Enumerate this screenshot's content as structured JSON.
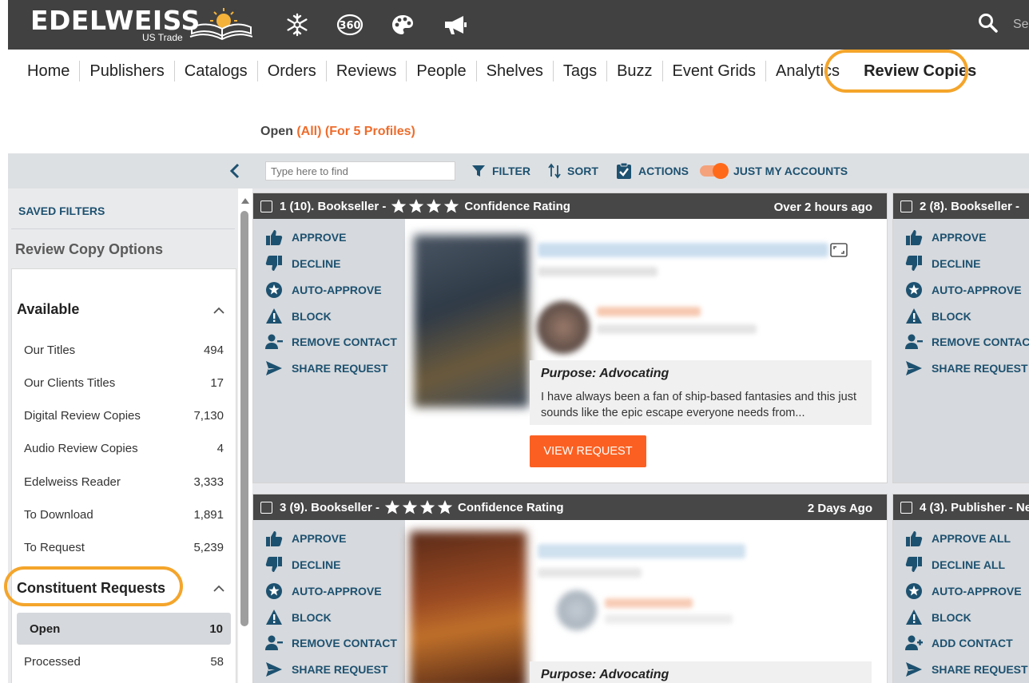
{
  "header": {
    "logo_text": "EDELWEISS",
    "logo_sub": "US Trade",
    "icons": [
      "snowflake-icon",
      "360-icon",
      "palette-icon",
      "megaphone-icon",
      "search-icon"
    ],
    "search_fragment": "Se"
  },
  "nav": {
    "items": [
      "Home",
      "Publishers",
      "Catalogs",
      "Orders",
      "Reviews",
      "People",
      "Shelves",
      "Tags",
      "Buzz",
      "Event Grids",
      "Analytics",
      "Review Copies"
    ],
    "active": "Review Copies"
  },
  "filter_line": {
    "label": "Open",
    "all": "(All)",
    "profiles": "(For 5 Profiles)"
  },
  "toolbar": {
    "search_placeholder": "Type here to find",
    "filter_label": "FILTER",
    "sort_label": "SORT",
    "actions_label": "ACTIONS",
    "toggle_label": "JUST MY ACCOUNTS",
    "toggle_on": true
  },
  "sidebar": {
    "saved_filters": "SAVED FILTERS",
    "options_title": "Review Copy Options",
    "available": {
      "title": "Available",
      "items": [
        {
          "label": "Our Titles",
          "count": "494"
        },
        {
          "label": "Our Clients Titles",
          "count": "17"
        },
        {
          "label": "Digital Review Copies",
          "count": "7,130"
        },
        {
          "label": "Audio Review Copies",
          "count": "4"
        },
        {
          "label": "Edelweiss Reader",
          "count": "3,333"
        },
        {
          "label": "To Download",
          "count": "1,891"
        },
        {
          "label": "To Request",
          "count": "5,239"
        }
      ]
    },
    "constituent": {
      "title": "Constituent Requests",
      "items": [
        {
          "label": "Open",
          "count": "10",
          "selected": true
        },
        {
          "label": "Processed",
          "count": "58"
        }
      ]
    }
  },
  "cards": [
    {
      "header": "1 (10). Bookseller -",
      "rating_label": "Confidence Rating",
      "time": "Over 2 hours ago",
      "actions": [
        "APPROVE",
        "DECLINE",
        "AUTO-APPROVE",
        "BLOCK",
        "REMOVE CONTACT",
        "SHARE REQUEST"
      ],
      "purpose_title": "Purpose: Advocating",
      "purpose_text": "I have always been a fan of ship-based fantasies and this just sounds like the epic escape everyone needs from...",
      "view_button": "VIEW REQUEST"
    },
    {
      "header": "2 (8). Bookseller -",
      "actions": [
        "APPROVE",
        "DECLINE",
        "AUTO-APPROVE",
        "BLOCK",
        "REMOVE CONTACT",
        "SHARE REQUEST"
      ]
    },
    {
      "header": "3 (9). Bookseller -",
      "rating_label": "Confidence Rating",
      "time": "2 Days Ago",
      "actions": [
        "APPROVE",
        "DECLINE",
        "AUTO-APPROVE",
        "BLOCK",
        "REMOVE CONTACT",
        "SHARE REQUEST"
      ],
      "purpose_title": "Purpose: Advocating"
    },
    {
      "header": "4 (3). Publisher - Ne",
      "actions": [
        "APPROVE ALL",
        "DECLINE ALL",
        "AUTO-APPROVE",
        "BLOCK",
        "ADD CONTACT",
        "SHARE REQUEST"
      ]
    }
  ],
  "colors": {
    "header_bg": "#414141",
    "accent_orange": "#fb6022",
    "action_blue": "#1d5170",
    "highlight_ring": "#f4a52b"
  }
}
